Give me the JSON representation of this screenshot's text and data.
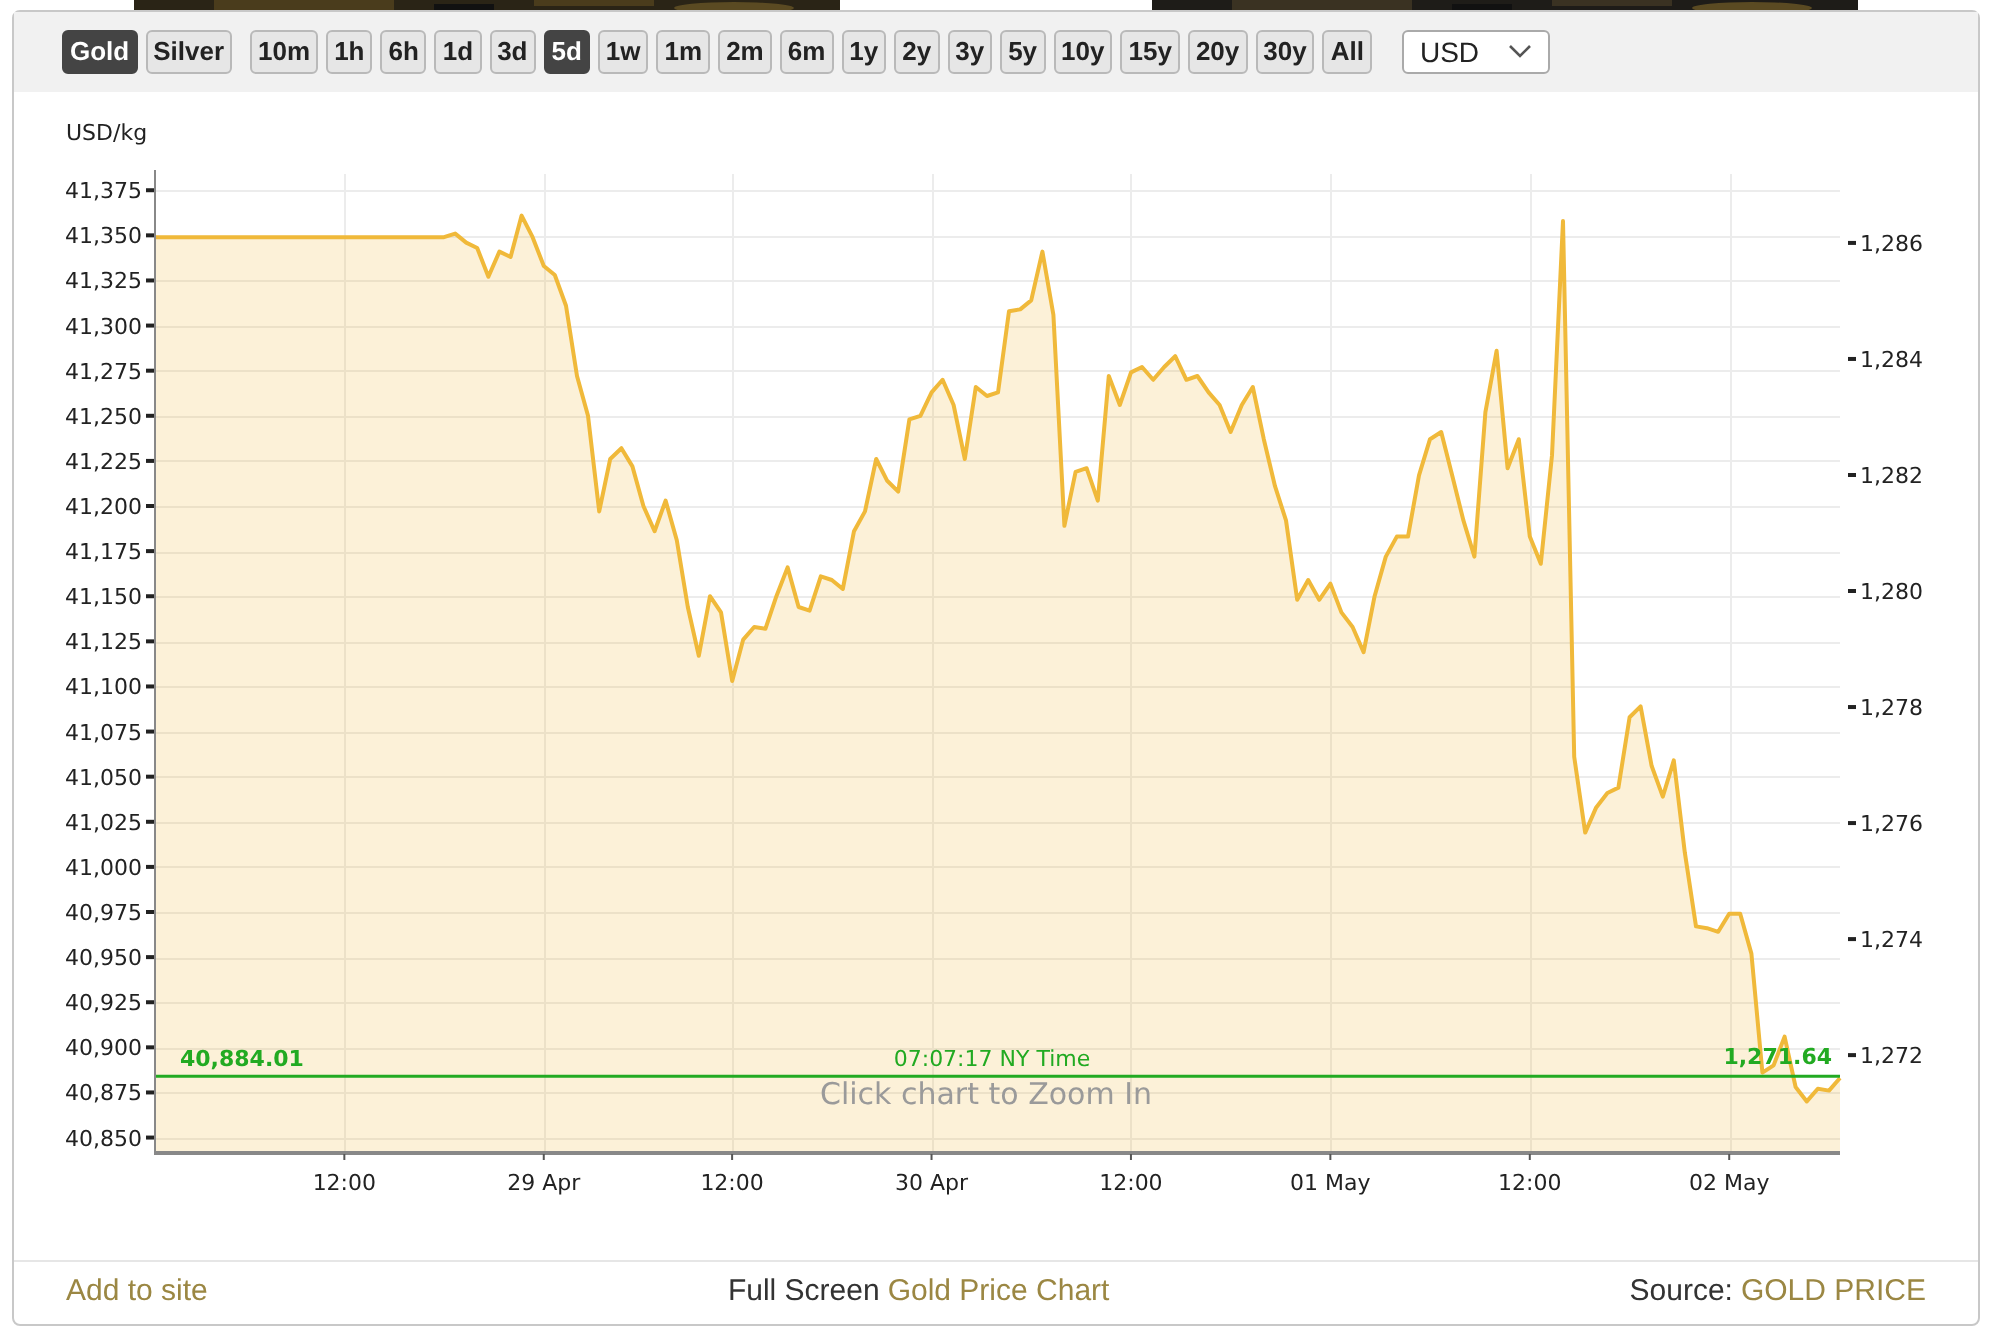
{
  "toolbar": {
    "metals": [
      {
        "label": "Gold",
        "selected": true
      },
      {
        "label": "Silver",
        "selected": false
      }
    ],
    "ranges": [
      {
        "label": "10m",
        "selected": false
      },
      {
        "label": "1h",
        "selected": false
      },
      {
        "label": "6h",
        "selected": false
      },
      {
        "label": "1d",
        "selected": false
      },
      {
        "label": "3d",
        "selected": false
      },
      {
        "label": "5d",
        "selected": true
      },
      {
        "label": "1w",
        "selected": false
      },
      {
        "label": "1m",
        "selected": false
      },
      {
        "label": "2m",
        "selected": false
      },
      {
        "label": "6m",
        "selected": false
      },
      {
        "label": "1y",
        "selected": false
      },
      {
        "label": "2y",
        "selected": false
      },
      {
        "label": "3y",
        "selected": false
      },
      {
        "label": "5y",
        "selected": false
      },
      {
        "label": "10y",
        "selected": false
      },
      {
        "label": "15y",
        "selected": false
      },
      {
        "label": "20y",
        "selected": false
      },
      {
        "label": "30y",
        "selected": false
      },
      {
        "label": "All",
        "selected": false
      }
    ],
    "currency": {
      "value": "USD"
    }
  },
  "chart": {
    "chart_data": {
      "type": "area",
      "ylabel": "USD/kg",
      "categories": [
        null,
        null,
        null,
        null,
        null,
        null,
        null,
        null,
        null,
        null,
        null,
        null,
        null,
        null,
        null,
        null,
        null,
        "12:00",
        null,
        null,
        null,
        null,
        null,
        null,
        null,
        null,
        null,
        null,
        null,
        null,
        null,
        null,
        null,
        null,
        null,
        "29 Apr",
        null,
        null,
        null,
        null,
        null,
        null,
        null,
        null,
        null,
        null,
        null,
        null,
        null,
        null,
        null,
        null,
        "12:00",
        null,
        null,
        null,
        null,
        null,
        null,
        null,
        null,
        null,
        null,
        null,
        null,
        null,
        null,
        null,
        null,
        null,
        "30 Apr",
        null,
        null,
        null,
        null,
        null,
        null,
        null,
        null,
        null,
        null,
        null,
        null,
        null,
        null,
        null,
        null,
        null,
        "12:00",
        null,
        null,
        null,
        null,
        null,
        null,
        null,
        null,
        null,
        null,
        null,
        null,
        null,
        null,
        null,
        null,
        null,
        "01 May",
        null,
        null,
        null,
        null,
        null,
        null,
        null,
        null,
        null,
        null,
        null,
        null,
        null,
        null,
        null,
        null,
        null,
        "12:00",
        null,
        null,
        null,
        null,
        null,
        null,
        null,
        null,
        null,
        null,
        null,
        null,
        null,
        null,
        null,
        null,
        null,
        "02 May",
        null,
        null,
        null,
        null,
        null,
        null,
        null,
        null,
        null,
        null
      ],
      "series": [
        {
          "color": "#f0b93a",
          "values": [
            41349,
            41349,
            41349,
            41349,
            41349,
            41349,
            41349,
            41349,
            41349,
            41349,
            41349,
            41349,
            41349,
            41349,
            41349,
            41349,
            41349,
            41349,
            41349,
            41349,
            41349,
            41349,
            41349,
            41349,
            41349,
            41349,
            41349,
            41351,
            41346,
            41343,
            41327,
            41341,
            41338,
            41361,
            41349,
            41333,
            41328,
            41311,
            41272,
            41250,
            41197,
            41226,
            41232,
            41222,
            41200,
            41186,
            41203,
            41181,
            41144,
            41117,
            41150,
            41141,
            41103,
            41126,
            41133,
            41132,
            41150,
            41166,
            41144,
            41142,
            41161,
            41159,
            41154,
            41186,
            41197,
            41226,
            41214,
            41208,
            41248,
            41250,
            41263,
            41270,
            41256,
            41226,
            41266,
            41261,
            41263,
            41308,
            41309,
            41314,
            41341,
            41306,
            41189,
            41219,
            41221,
            41203,
            41272,
            41256,
            41274,
            41277,
            41270,
            41277,
            41283,
            41270,
            41272,
            41263,
            41256,
            41241,
            41256,
            41266,
            41237,
            41211,
            41192,
            41148,
            41159,
            41148,
            41157,
            41141,
            41133,
            41119,
            41150,
            41172,
            41183,
            41183,
            41217,
            41237,
            41241,
            41217,
            41192,
            41172,
            41252,
            41286,
            41221,
            41237,
            41183,
            41168,
            41228,
            41358,
            41061,
            41019,
            41033,
            41041,
            41044,
            41083,
            41089,
            41056,
            41039,
            41059,
            41008,
            40967,
            40966,
            40964,
            40974,
            40974,
            40952,
            40886,
            40890,
            40906,
            40878,
            40870,
            40877,
            40876,
            40883
          ]
        }
      ],
      "ylim": [
        40842,
        41384
      ],
      "yticks": [
        {
          "value": 40850,
          "label": "40,850"
        },
        {
          "value": 40875,
          "label": "40,875"
        },
        {
          "value": 40900,
          "label": "40,900"
        },
        {
          "value": 40925,
          "label": "40,925"
        },
        {
          "value": 40950,
          "label": "40,950"
        },
        {
          "value": 40975,
          "label": "40,975"
        },
        {
          "value": 41000,
          "label": "41,000"
        },
        {
          "value": 41025,
          "label": "41,025"
        },
        {
          "value": 41050,
          "label": "41,050"
        },
        {
          "value": 41075,
          "label": "41,075"
        },
        {
          "value": 41100,
          "label": "41,100"
        },
        {
          "value": 41125,
          "label": "41,125"
        },
        {
          "value": 41150,
          "label": "41,150"
        },
        {
          "value": 41175,
          "label": "41,175"
        },
        {
          "value": 41200,
          "label": "41,200"
        },
        {
          "value": 41225,
          "label": "41,225"
        },
        {
          "value": 41250,
          "label": "41,250"
        },
        {
          "value": 41275,
          "label": "41,275"
        },
        {
          "value": 41300,
          "label": "41,300"
        },
        {
          "value": 41325,
          "label": "41,325"
        },
        {
          "value": 41350,
          "label": "41,350"
        },
        {
          "value": 41375,
          "label": "41,375"
        }
      ],
      "grid": true,
      "ref_lines": [
        {
          "axis": "y",
          "value": 40884.01,
          "color": "#22aa22",
          "label": "40,884.01"
        }
      ]
    },
    "right_axis_labels": [
      "1,286",
      "1,284",
      "1,282",
      "1,280",
      "1,278",
      "1,276",
      "1,274",
      "1,272"
    ],
    "price_line": {
      "center_label": "07:07:17 NY Time",
      "right_label": "1,271.64"
    },
    "zoom_hint": "Click chart to Zoom In"
  },
  "footer": {
    "left_link": "Add to site",
    "center_text": "Full Screen",
    "center_link": "Gold Price Chart",
    "right_text": "Source:",
    "right_link": "GOLD PRICE"
  }
}
